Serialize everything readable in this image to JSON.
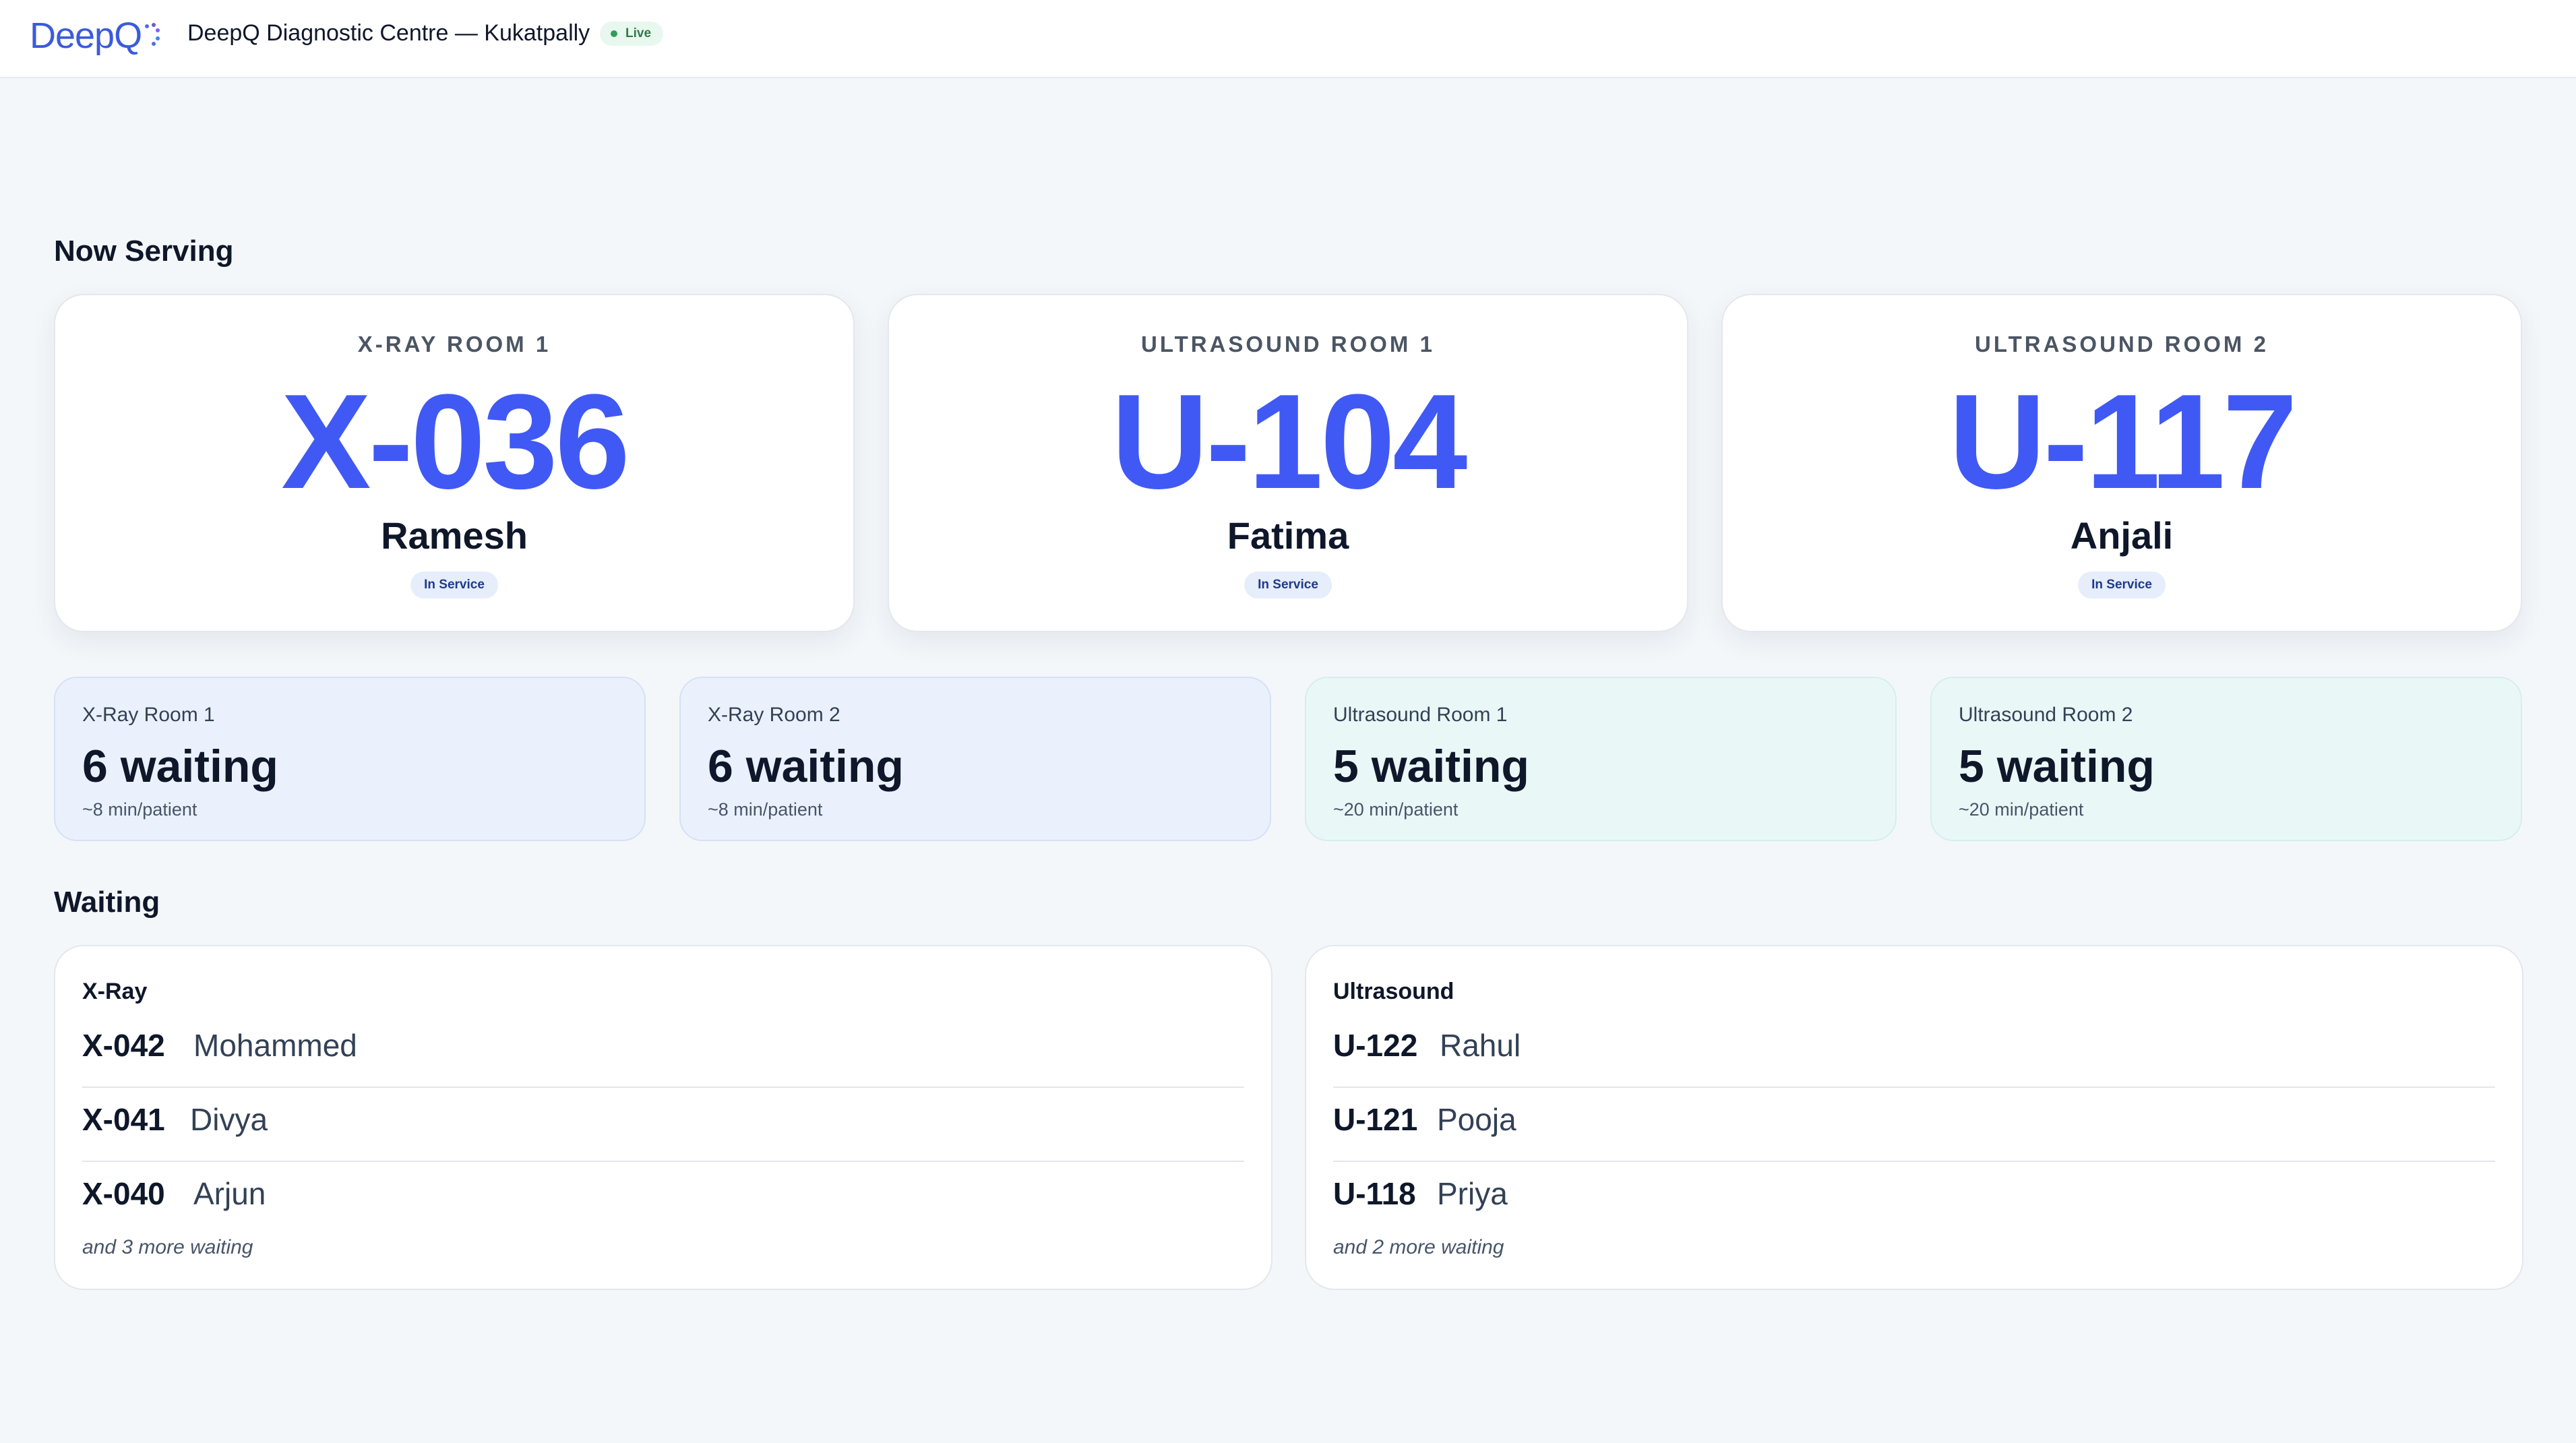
{
  "header": {
    "logo_text": "DeepQ",
    "title": "DeepQ Diagnostic Centre — Kukatpally",
    "status_badge": "Live"
  },
  "sections": {
    "now_serving": "Now Serving",
    "waiting": "Waiting"
  },
  "now_serving": [
    {
      "room": "X-RAY ROOM 1",
      "token": "X-036",
      "name": "Ramesh",
      "status": "In Service"
    },
    {
      "room": "ULTRASOUND ROOM 1",
      "token": "U-104",
      "name": "Fatima",
      "status": "In Service"
    },
    {
      "room": "ULTRASOUND ROOM 2",
      "token": "U-117",
      "name": "Anjali",
      "status": "In Service"
    }
  ],
  "room_waits": [
    {
      "room": "X-Ray Room 1",
      "count": "6 waiting",
      "rate": "~8 min/patient"
    },
    {
      "room": "X-Ray Room 2",
      "count": "6 waiting",
      "rate": "~8 min/patient"
    },
    {
      "room": "Ultrasound Room 1",
      "count": "5 waiting",
      "rate": "~20 min/patient"
    },
    {
      "room": "Ultrasound Room 2",
      "count": "5 waiting",
      "rate": "~20 min/patient"
    }
  ],
  "queues": [
    {
      "title": "X-Ray",
      "items": [
        {
          "token": "X-042",
          "name": "Mohammed"
        },
        {
          "token": "X-041",
          "name": "Divya"
        },
        {
          "token": "X-040",
          "name": "Arjun"
        }
      ],
      "more": "and 3 more waiting"
    },
    {
      "title": "Ultrasound",
      "items": [
        {
          "token": "U-122",
          "name": "Rahul"
        },
        {
          "token": "U-121",
          "name": "Pooja"
        },
        {
          "token": "U-118",
          "name": "Priya"
        }
      ],
      "more": "and 2 more waiting"
    }
  ],
  "colors": {
    "accent": "#4059f5",
    "live": "#2f9e5a",
    "xray_card": "#eaf1fd",
    "ultrasound_card": "#e9f8f7"
  }
}
